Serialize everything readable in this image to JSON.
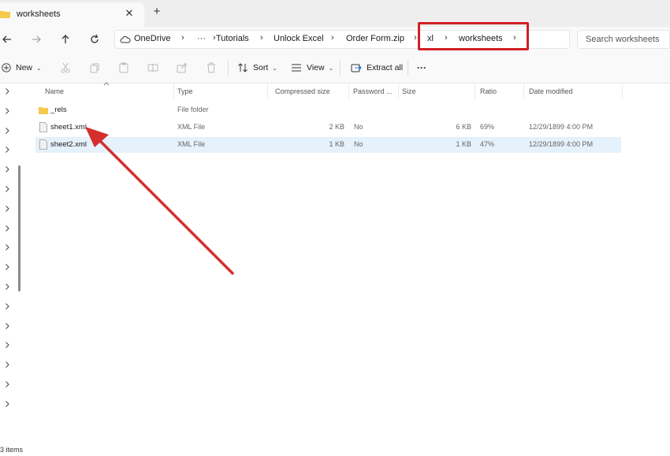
{
  "window": {
    "tab_title": "worksheets",
    "tab_close_glyph": "✕",
    "new_tab_glyph": "+"
  },
  "address": {
    "breadcrumbs": [
      "OneDrive",
      "···",
      "Tutorials",
      "Unlock Excel",
      "Order Form.zip",
      "xl",
      "worksheets"
    ],
    "search_placeholder": "Search worksheets"
  },
  "toolbar": {
    "new_label": "New",
    "sort_label": "Sort",
    "view_label": "View",
    "extract_label": "Extract all",
    "more_glyph": "···"
  },
  "columns": {
    "name": "Name",
    "type": "Type",
    "compressed_size": "Compressed size",
    "password": "Password ...",
    "size": "Size",
    "ratio": "Ratio",
    "date_modified": "Date modified"
  },
  "files": [
    {
      "name": "_rels",
      "type": "File folder",
      "compressed": "",
      "password": "",
      "size": "",
      "ratio": "",
      "date": "",
      "icon": "folder-icon"
    },
    {
      "name": "sheet1.xml",
      "type": "XML File",
      "compressed": "2 KB",
      "password": "No",
      "size": "6 KB",
      "ratio": "69%",
      "date": "12/29/1899 4:00 PM",
      "icon": "xml-file-icon"
    },
    {
      "name": "sheet2.xml",
      "type": "XML File",
      "compressed": "1 KB",
      "password": "No",
      "size": "1 KB",
      "ratio": "47%",
      "date": "12/29/1899 4:00 PM",
      "icon": "xml-file-icon"
    }
  ],
  "status": {
    "item_count": "3 items"
  },
  "colors": {
    "highlight_box": "#d21f25",
    "arrow": "#d32f2f",
    "selected_row": "#e5f1fb",
    "folder": "#f7c94b"
  }
}
